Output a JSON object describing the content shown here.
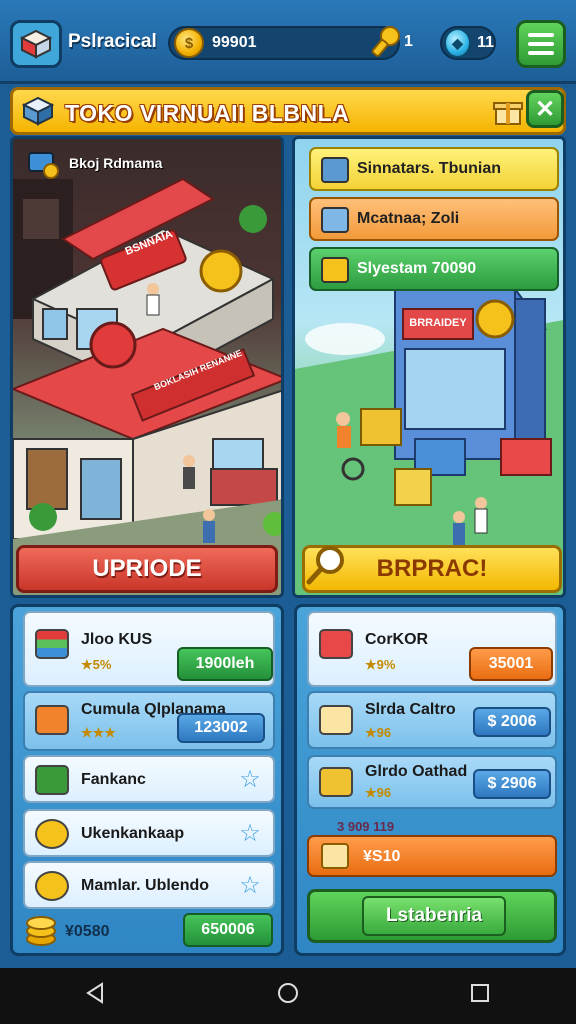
{
  "topbar": {
    "brand": "Pslracical",
    "coins": "99901",
    "keys": "1",
    "gems": "11"
  },
  "banner": {
    "title": "TOKO VIRNUAII BLBNLA",
    "close_glyph": "✕"
  },
  "scene_left": {
    "label": "Bkoj Rdmama",
    "sign_top": "BSNNAIA",
    "sign_front": "BOKLASIH RENANNE",
    "button": "UPRIODE"
  },
  "scene_right": {
    "tags": [
      {
        "label": "Sinnatars. Tbunian",
        "style": "yellow"
      },
      {
        "label": "Mcatnaa; Zoli",
        "style": "orange"
      },
      {
        "label": "Slyestam 70090",
        "style": "green"
      }
    ],
    "sign": "BRRAIDEY",
    "button": "BRPRAC!"
  },
  "left_list": [
    {
      "title": "Jloo KUS",
      "stars": "★5%",
      "price": "1900leh"
    },
    {
      "title": "Cumula Qlplanama",
      "stars": "★★★",
      "price": "123002"
    },
    {
      "title": "Fankanc"
    },
    {
      "title": "Ukenkankaap"
    },
    {
      "title": "Mamlar. Ublendo"
    }
  ],
  "left_footer": {
    "amount": "¥0580",
    "button": "650006"
  },
  "right_list": [
    {
      "title": "CorKOR",
      "stars": "★9%",
      "price": "35001"
    },
    {
      "title": "Slrda Caltro",
      "stars": "★96",
      "price": "$ 2006"
    },
    {
      "title": "Glrdo Oathad",
      "stars": "★96",
      "price": "$ 2906"
    }
  ],
  "right_footer": {
    "note": "3 909 119",
    "orange_label": "¥S10",
    "button": "Lstabenria"
  },
  "colors": {
    "bg": "#1c5d96",
    "banner": "#f5b400",
    "accent_green": "#2e9b34",
    "accent_red": "#c9362a"
  }
}
